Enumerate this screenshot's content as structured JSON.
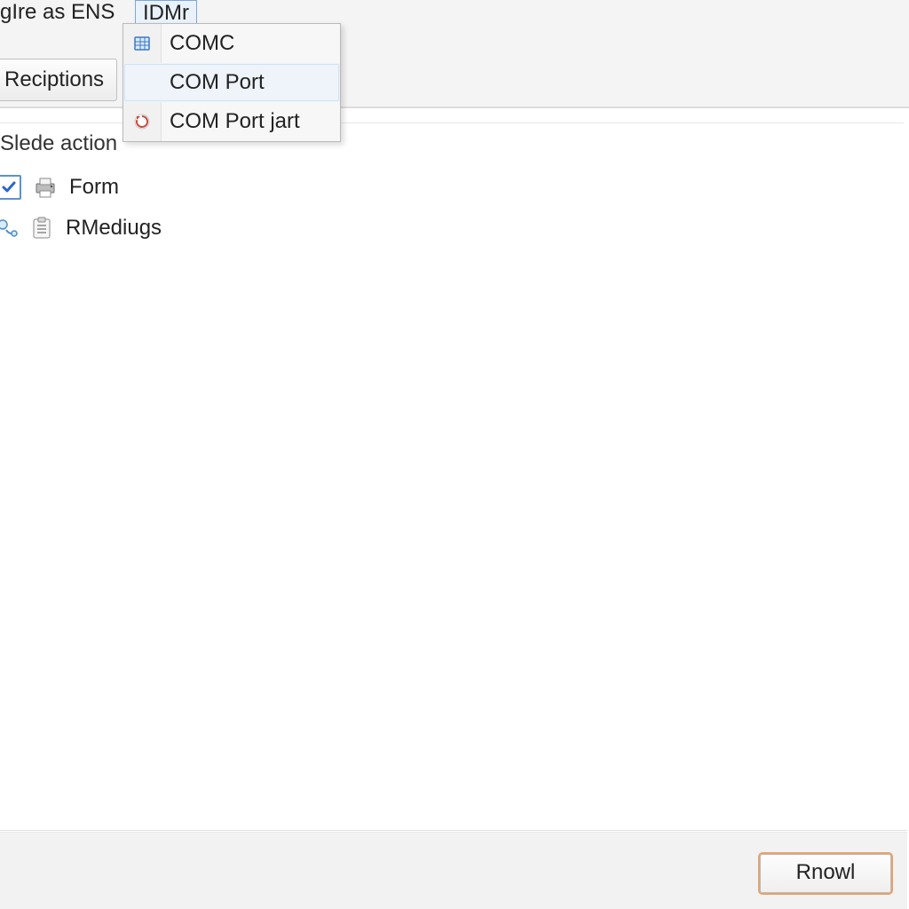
{
  "menubar": {
    "partial_text": "gIre as ENS",
    "open_menu_label": "IDMr"
  },
  "toolbar": {
    "reciptions_label": "Reciptions"
  },
  "dropdown": {
    "items": [
      {
        "icon": "grid-icon",
        "label": "COMC"
      },
      {
        "icon": "blank-icon",
        "label": "COM Port"
      },
      {
        "icon": "refresh-icon",
        "label": "COM Port jart"
      }
    ],
    "hover_index": 1
  },
  "section": {
    "label": "Slede action"
  },
  "list": {
    "rows": [
      {
        "checked": true,
        "icon": "printer-icon",
        "label": "Form"
      },
      {
        "checked": null,
        "icon": "clipboard-icon",
        "label": "RMediugs"
      }
    ]
  },
  "footer": {
    "primary_button": "Rnowl"
  }
}
